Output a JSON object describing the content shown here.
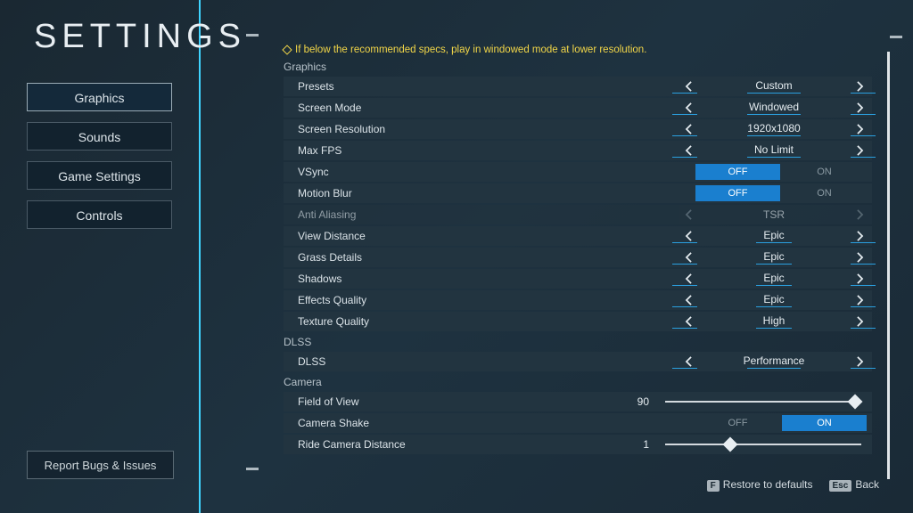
{
  "title": "SETTINGS",
  "warning": "If below the recommended specs, play in windowed mode at lower resolution.",
  "nav": {
    "graphics": "Graphics",
    "sounds": "Sounds",
    "game_settings": "Game Settings",
    "controls": "Controls",
    "report": "Report Bugs & Issues"
  },
  "sections": {
    "graphics": "Graphics",
    "dlss": "DLSS",
    "camera": "Camera"
  },
  "rows": {
    "presets": {
      "label": "Presets",
      "value": "Custom"
    },
    "screen_mode": {
      "label": "Screen Mode",
      "value": "Windowed"
    },
    "resolution": {
      "label": "Screen Resolution",
      "value": "1920x1080"
    },
    "max_fps": {
      "label": "Max FPS",
      "value": "No Limit"
    },
    "vsync": {
      "label": "VSync",
      "off": "OFF",
      "on": "ON",
      "active": "off"
    },
    "motion_blur": {
      "label": "Motion Blur",
      "off": "OFF",
      "on": "ON",
      "active": "off"
    },
    "anti_aliasing": {
      "label": "Anti Aliasing",
      "value": "TSR"
    },
    "view_distance": {
      "label": "View Distance",
      "value": "Epic"
    },
    "grass": {
      "label": "Grass Details",
      "value": "Epic"
    },
    "shadows": {
      "label": "Shadows",
      "value": "Epic"
    },
    "effects": {
      "label": "Effects Quality",
      "value": "Epic"
    },
    "texture": {
      "label": "Texture Quality",
      "value": "High"
    },
    "dlss": {
      "label": "DLSS",
      "value": "Performance"
    },
    "fov": {
      "label": "Field of View",
      "value": "90",
      "pct": 97
    },
    "camera_shake": {
      "label": "Camera Shake",
      "off": "OFF",
      "on": "ON",
      "active": "on"
    },
    "ride_cam": {
      "label": "Ride Camera Distance",
      "value": "1",
      "pct": 33
    }
  },
  "footer": {
    "restore_key": "F",
    "restore": "Restore to defaults",
    "back_key": "Esc",
    "back": "Back"
  }
}
